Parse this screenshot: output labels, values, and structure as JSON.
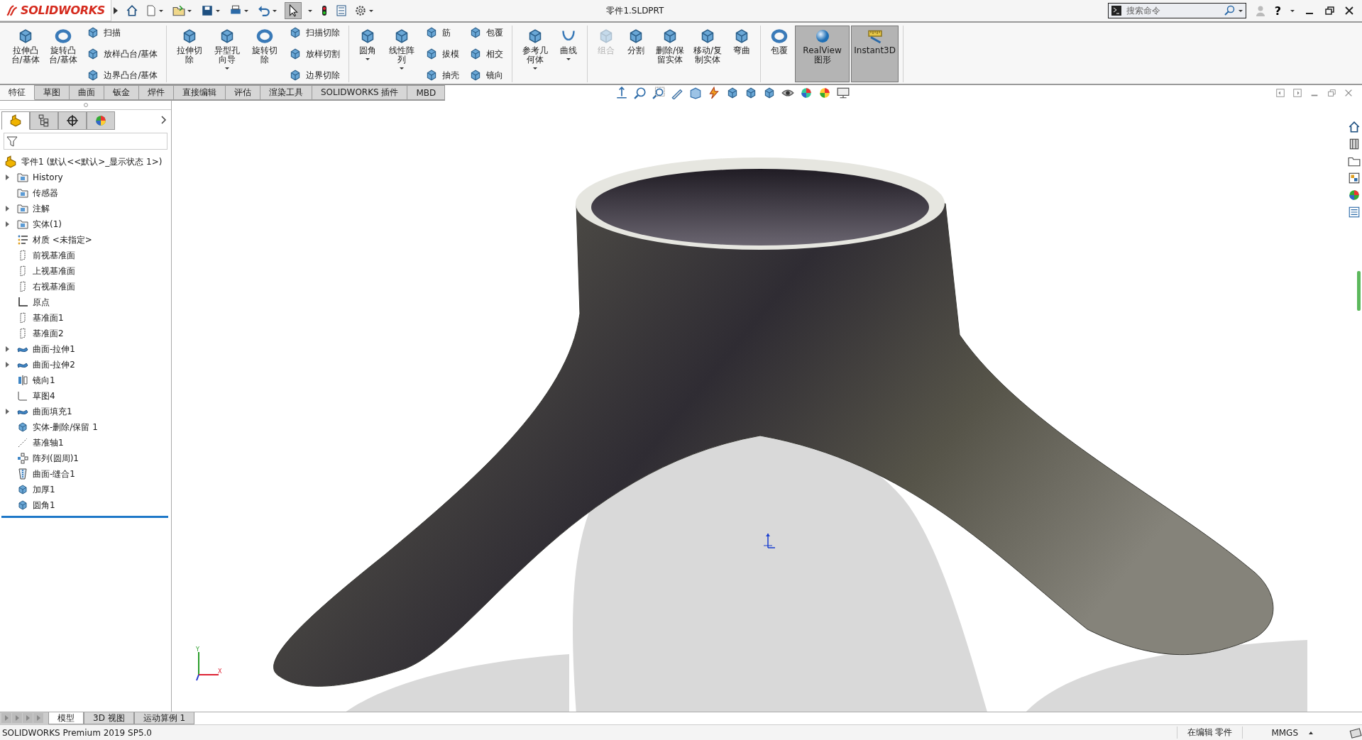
{
  "title_bar": {
    "logo": "SOLIDWORKS",
    "title": "零件1.SLDPRT",
    "search": {
      "placeholder": "搜索命令"
    },
    "help": "?"
  },
  "ribbon": {
    "groups": [
      {
        "items": [
          {
            "kind": "large",
            "label": "拉伸凸台/基体",
            "dropdown": false,
            "disabled": false,
            "selected": false
          },
          {
            "kind": "large",
            "label": "旋转凸台/基体",
            "dropdown": false,
            "disabled": false,
            "selected": false
          },
          {
            "kind": "stack",
            "entries": [
              "扫描",
              "放样凸台/基体",
              "边界凸台/基体"
            ]
          }
        ]
      },
      {
        "items": [
          {
            "kind": "large",
            "label": "拉伸切除",
            "dropdown": false,
            "disabled": false,
            "selected": false
          },
          {
            "kind": "large",
            "label": "异型孔向导",
            "dropdown": true,
            "disabled": false,
            "selected": false
          },
          {
            "kind": "large",
            "label": "旋转切除",
            "dropdown": false,
            "disabled": false,
            "selected": false
          },
          {
            "kind": "stack",
            "entries": [
              "扫描切除",
              "放样切割",
              "边界切除"
            ]
          }
        ]
      },
      {
        "items": [
          {
            "kind": "large",
            "label": "圆角",
            "dropdown": true,
            "disabled": false,
            "selected": false
          },
          {
            "kind": "large",
            "label": "线性阵列",
            "dropdown": true,
            "disabled": false,
            "selected": false
          },
          {
            "kind": "stack",
            "entries": [
              "筋",
              "拔模",
              "抽壳"
            ]
          },
          {
            "kind": "stack",
            "entries": [
              "包覆",
              "相交",
              "镜向"
            ]
          }
        ]
      },
      {
        "items": [
          {
            "kind": "large",
            "label": "参考几何体",
            "dropdown": true,
            "disabled": false,
            "selected": false
          },
          {
            "kind": "large",
            "label": "曲线",
            "dropdown": true,
            "disabled": false,
            "selected": false
          }
        ]
      },
      {
        "items": [
          {
            "kind": "large",
            "label": "组合",
            "dropdown": false,
            "disabled": true,
            "selected": false
          },
          {
            "kind": "large",
            "label": "分割",
            "dropdown": false,
            "disabled": false,
            "selected": false
          },
          {
            "kind": "large",
            "label": "删除/保留实体",
            "dropdown": false,
            "disabled": false,
            "selected": false
          },
          {
            "kind": "large",
            "label": "移动/复制实体",
            "dropdown": false,
            "disabled": false,
            "selected": false
          },
          {
            "kind": "large",
            "label": "弯曲",
            "dropdown": false,
            "disabled": false,
            "selected": false
          }
        ]
      },
      {
        "items": [
          {
            "kind": "large",
            "label": "包覆",
            "dropdown": false,
            "disabled": false,
            "selected": false
          },
          {
            "kind": "large",
            "label": "RealView 图形",
            "dropdown": false,
            "disabled": false,
            "selected": true
          },
          {
            "kind": "large",
            "label": "Instant3D",
            "dropdown": false,
            "disabled": false,
            "selected": true
          }
        ]
      }
    ]
  },
  "command_tabs": [
    {
      "label": "特征",
      "selected": true
    },
    {
      "label": "草图",
      "selected": false
    },
    {
      "label": "曲面",
      "selected": false
    },
    {
      "label": "钣金",
      "selected": false
    },
    {
      "label": "焊件",
      "selected": false
    },
    {
      "label": "直接编辑",
      "selected": false
    },
    {
      "label": "评估",
      "selected": false
    },
    {
      "label": "渲染工具",
      "selected": false
    },
    {
      "label": "SOLIDWORKS 插件",
      "selected": false
    },
    {
      "label": "MBD",
      "selected": false
    }
  ],
  "panel_tabs": [
    {
      "selected": true
    },
    {
      "selected": false
    },
    {
      "selected": false
    },
    {
      "selected": false
    }
  ],
  "feature_tree": {
    "root": "零件1  (默认<<默认>_显示状态 1>)",
    "items": [
      {
        "label": "History",
        "kind": "folder",
        "expandable": true
      },
      {
        "label": "传感器",
        "kind": "folder",
        "expandable": false
      },
      {
        "label": "注解",
        "kind": "folder",
        "expandable": true
      },
      {
        "label": "实体(1)",
        "kind": "folder",
        "expandable": true
      },
      {
        "label": "材质 <未指定>",
        "kind": "material",
        "expandable": false
      },
      {
        "label": "前视基准面",
        "kind": "plane",
        "expandable": false
      },
      {
        "label": "上视基准面",
        "kind": "plane",
        "expandable": false
      },
      {
        "label": "右视基准面",
        "kind": "plane",
        "expandable": false
      },
      {
        "label": "原点",
        "kind": "origin",
        "expandable": false
      },
      {
        "label": "基准面1",
        "kind": "plane",
        "expandable": false
      },
      {
        "label": "基准面2",
        "kind": "plane",
        "expandable": false
      },
      {
        "label": "曲面-拉伸1",
        "kind": "surface",
        "expandable": true
      },
      {
        "label": "曲面-拉伸2",
        "kind": "surface",
        "expandable": true
      },
      {
        "label": "镜向1",
        "kind": "mirror",
        "expandable": false
      },
      {
        "label": "草图4",
        "kind": "sketch",
        "expandable": false
      },
      {
        "label": "曲面填充1",
        "kind": "surface",
        "expandable": true
      },
      {
        "label": "实体-删除/保留 1",
        "kind": "body",
        "expandable": false
      },
      {
        "label": "基准轴1",
        "kind": "axis",
        "expandable": false
      },
      {
        "label": "阵列(圆周)1",
        "kind": "pattern",
        "expandable": false
      },
      {
        "label": "曲面-缝合1",
        "kind": "knit",
        "expandable": false
      },
      {
        "label": "加厚1",
        "kind": "body",
        "expandable": false
      },
      {
        "label": "圆角1",
        "kind": "body",
        "expandable": false
      }
    ]
  },
  "viewport": {
    "triad": {
      "y": "Y",
      "x": "X"
    }
  },
  "bottom_tabs": [
    {
      "label": "模型",
      "selected": true
    },
    {
      "label": "3D 视图",
      "selected": false
    },
    {
      "label": "运动算例 1",
      "selected": false
    }
  ],
  "status_bar": {
    "version": "SOLIDWORKS Premium 2019 SP5.0",
    "mode": "在编辑 零件",
    "units": "MMGS"
  }
}
